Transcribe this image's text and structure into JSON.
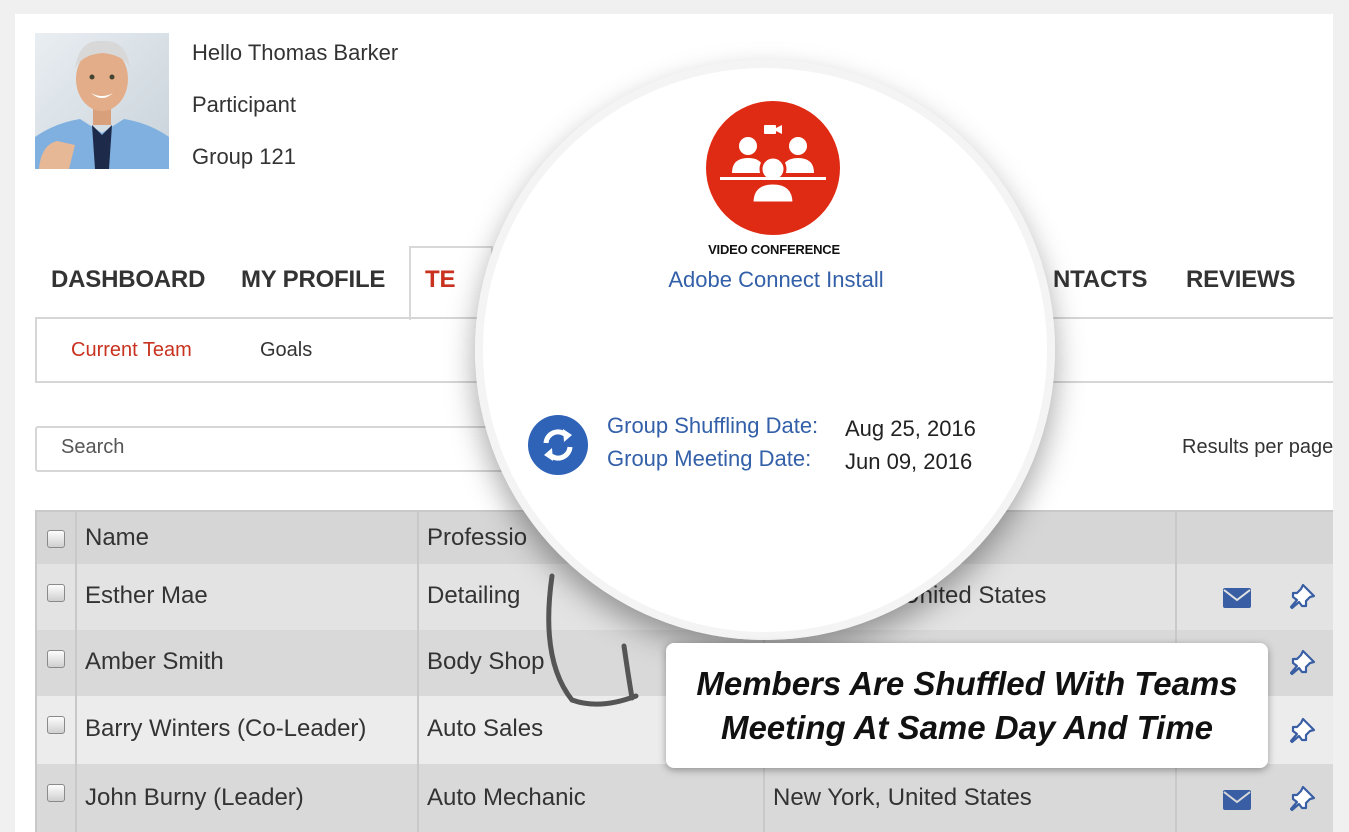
{
  "user": {
    "greeting": "Hello Thomas Barker",
    "role": "Participant",
    "group": "Group 121"
  },
  "tabs": [
    {
      "label": "DASHBOARD"
    },
    {
      "label": "MY PROFILE"
    },
    {
      "label": "TE"
    },
    {
      "label": "NTACTS"
    },
    {
      "label": "REVIEWS"
    }
  ],
  "subnav": {
    "items": [
      {
        "label": "Current Team"
      },
      {
        "label": "Goals"
      }
    ]
  },
  "search": {
    "placeholder": "Search"
  },
  "results_per_page_label": "Results per page",
  "table": {
    "headers": [
      "Name",
      "Professio"
    ],
    "rows": [
      {
        "name": "Esther Mae",
        "profession": "Detailing",
        "location": ", United States"
      },
      {
        "name": "Amber Smith",
        "profession": "Body Shop",
        "location": ""
      },
      {
        "name": "Barry Winters (Co-Leader)",
        "profession": "Auto Sales",
        "location": ""
      },
      {
        "name": "John Burny (Leader)",
        "profession": "Auto Mechanic",
        "location": "New York, United States"
      }
    ]
  },
  "magnifier": {
    "video_conference_label": "VIDEO CONFERENCE",
    "adobe_link": "Adobe Connect Install",
    "shuffling_label": "Group Shuffling Date:",
    "shuffling_date": "Aug 25, 2016",
    "meeting_label": "Group Meeting Date:",
    "meeting_date": "Jun 09, 2016"
  },
  "callout": {
    "line1": "Members Are Shuffled With Teams",
    "line2": "Meeting At Same Day And Time"
  },
  "colors": {
    "accent": "#c8321f",
    "link": "#3360a8",
    "video_red": "#e02b14",
    "shuffle_blue": "#2f63b8"
  }
}
